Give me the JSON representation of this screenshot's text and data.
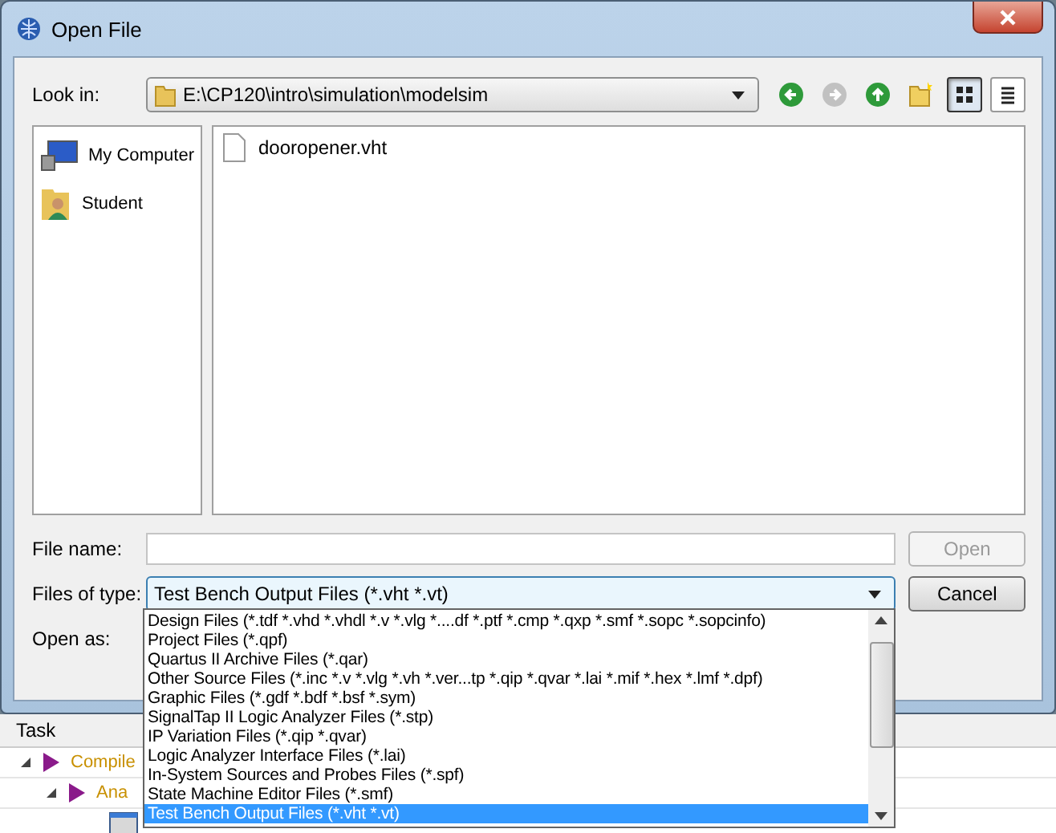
{
  "window": {
    "title": "Open File"
  },
  "look_in": {
    "label": "Look in:",
    "value": "E:\\CP120\\intro\\simulation\\modelsim"
  },
  "nav_buttons": [
    {
      "kind": "back",
      "disabled": false
    },
    {
      "kind": "forward",
      "disabled": true
    },
    {
      "kind": "up",
      "disabled": false
    },
    {
      "kind": "new-folder",
      "disabled": false
    }
  ],
  "view_buttons": [
    {
      "kind": "list",
      "selected": true
    },
    {
      "kind": "details",
      "selected": false
    }
  ],
  "places": [
    {
      "label": "My Computer",
      "kind": "computer"
    },
    {
      "label": "Student",
      "kind": "user"
    }
  ],
  "files": [
    {
      "name": "dooropener.vht"
    }
  ],
  "file_name": {
    "label": "File name:"
  },
  "files_of_type": {
    "label": "Files of type:",
    "value": "Test Bench Output Files (*.vht *.vt)",
    "expanded": true,
    "options": [
      {
        "label": "Design Files (*.tdf *.vhd *.vhdl *.v *.vlg *....df *.ptf *.cmp *.qxp *.smf *.sopc *.sopcinfo)",
        "selected": false
      },
      {
        "label": "Project Files (*.qpf)",
        "selected": false
      },
      {
        "label": "Quartus II Archive Files (*.qar)",
        "selected": false
      },
      {
        "label": "Other Source Files (*.inc *.v *.vlg *.vh *.ver...tp *.qip *.qvar *.lai *.mif *.hex *.lmf *.dpf)",
        "selected": false
      },
      {
        "label": "Graphic Files (*.gdf *.bdf *.bsf *.sym)",
        "selected": false
      },
      {
        "label": "SignalTap II Logic Analyzer Files (*.stp)",
        "selected": false
      },
      {
        "label": "IP Variation Files (*.qip *.qvar)",
        "selected": false
      },
      {
        "label": "Logic Analyzer Interface Files (*.lai)",
        "selected": false
      },
      {
        "label": "In-System Sources and Probes Files (*.spf)",
        "selected": false
      },
      {
        "label": "State Machine Editor Files (*.smf)",
        "selected": false
      },
      {
        "label": "Test Bench Output Files (*.vht *.vt)",
        "selected": true
      }
    ]
  },
  "open_as": {
    "label": "Open as:"
  },
  "buttons": [
    {
      "label": "Open",
      "disabled": true
    },
    {
      "label": "Cancel",
      "disabled": false
    }
  ],
  "background": {
    "header": "Task",
    "tasks": [
      {
        "label": "Compile",
        "children": [
          {
            "label": "Ana"
          }
        ]
      }
    ]
  }
}
